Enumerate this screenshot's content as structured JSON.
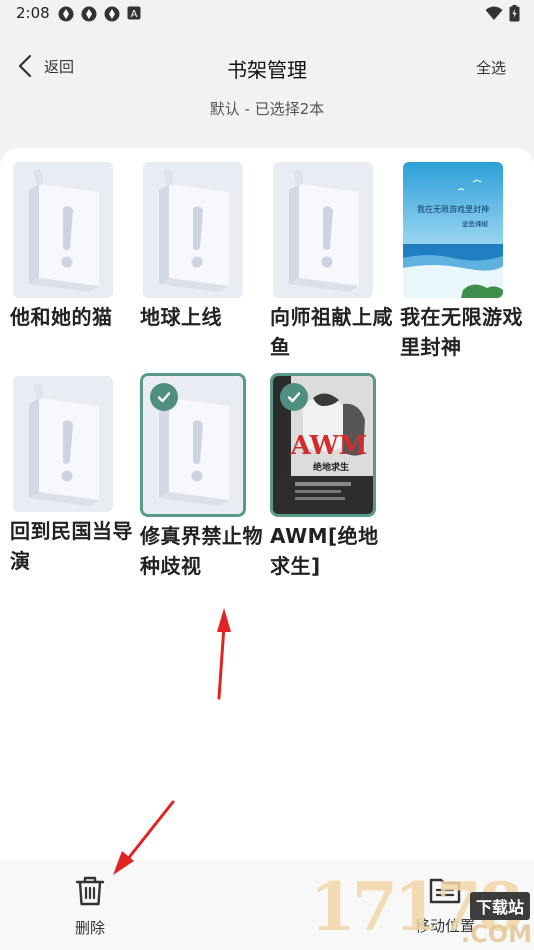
{
  "status_bar": {
    "time": "2:08",
    "notification_icons": [
      "app-notification-icon",
      "app-notification-icon",
      "app-notification-icon",
      "a-badge-icon"
    ],
    "system_icons": [
      "wifi-icon",
      "battery-icon"
    ]
  },
  "header": {
    "back_label": "返回",
    "title": "书架管理",
    "select_all_label": "全选"
  },
  "subtitle": "默认 - 已选择2本",
  "books": [
    {
      "title": "他和她的猫",
      "cover": "placeholder",
      "selected": false
    },
    {
      "title": "地球上线",
      "cover": "placeholder",
      "selected": false
    },
    {
      "title": "向师祖献上咸鱼",
      "cover": "placeholder",
      "selected": false
    },
    {
      "title": "我在无限游戏里封神",
      "cover": "image",
      "cover_text": "我在无限游戏里封神",
      "cover_author": "壶鱼辣椒",
      "selected": false
    },
    {
      "title": "回到民国当导演",
      "cover": "placeholder",
      "selected": false
    },
    {
      "title": "修真界禁止物种歧视",
      "cover": "placeholder",
      "selected": true
    },
    {
      "title": "AWM[绝地求生]",
      "cover": "image",
      "cover_text": "AWM",
      "cover_subtitle": "绝地求生",
      "selected": true
    }
  ],
  "bottom_bar": {
    "delete_label": "删除",
    "move_label": "移动位置"
  },
  "watermark": {
    "digits": "17178",
    "badge": "下载站",
    "domain": ".COM"
  },
  "colors": {
    "accent_selected": "#4f8f7f",
    "annotation_arrow": "#e02424"
  }
}
